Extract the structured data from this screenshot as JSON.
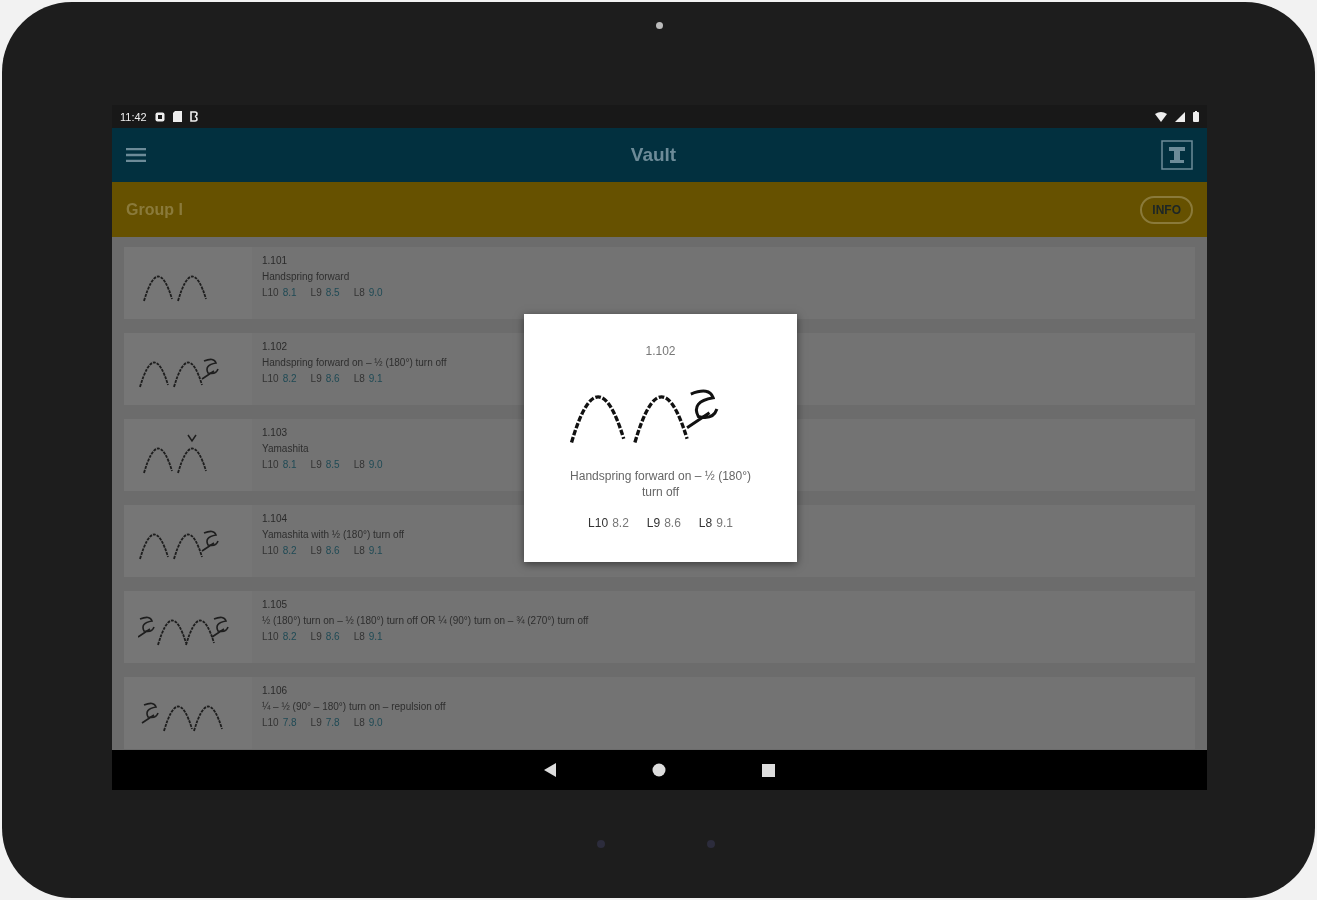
{
  "status_bar": {
    "time": "11:42"
  },
  "app_bar": {
    "title": "Vault"
  },
  "group_header": {
    "title": "Group I",
    "button": "INFO"
  },
  "skills": [
    {
      "code": "1.101",
      "name": "Handspring forward",
      "scores": [
        {
          "level": "L10",
          "value": "8.1"
        },
        {
          "level": "L9",
          "value": "8.5"
        },
        {
          "level": "L8",
          "value": "9.0"
        }
      ]
    },
    {
      "code": "1.102",
      "name": "Handspring forward on – ½ (180°) turn off",
      "scores": [
        {
          "level": "L10",
          "value": "8.2"
        },
        {
          "level": "L9",
          "value": "8.6"
        },
        {
          "level": "L8",
          "value": "9.1"
        }
      ]
    },
    {
      "code": "1.103",
      "name": "Yamashita",
      "scores": [
        {
          "level": "L10",
          "value": "8.1"
        },
        {
          "level": "L9",
          "value": "8.5"
        },
        {
          "level": "L8",
          "value": "9.0"
        }
      ]
    },
    {
      "code": "1.104",
      "name": "Yamashita with ½ (180°) turn off",
      "scores": [
        {
          "level": "L10",
          "value": "8.2"
        },
        {
          "level": "L9",
          "value": "8.6"
        },
        {
          "level": "L8",
          "value": "9.1"
        }
      ]
    },
    {
      "code": "1.105",
      "name": "½ (180°) turn on – ½ (180°) turn off OR ¼ (90°) turn on – ¾ (270°) turn off",
      "scores": [
        {
          "level": "L10",
          "value": "8.2"
        },
        {
          "level": "L9",
          "value": "8.6"
        },
        {
          "level": "L8",
          "value": "9.1"
        }
      ]
    },
    {
      "code": "1.106",
      "name": "¼ – ½ (90° – 180°) turn on – repulsion off",
      "scores": [
        {
          "level": "L10",
          "value": "7.8"
        },
        {
          "level": "L9",
          "value": "7.8"
        },
        {
          "level": "L8",
          "value": "9.0"
        }
      ]
    }
  ],
  "dialog": {
    "code": "1.102",
    "name": "Handspring forward on – ½ (180°) turn off",
    "scores": [
      {
        "level": "L10",
        "value": "8.2"
      },
      {
        "level": "L9",
        "value": "8.6"
      },
      {
        "level": "L8",
        "value": "9.1"
      }
    ]
  }
}
